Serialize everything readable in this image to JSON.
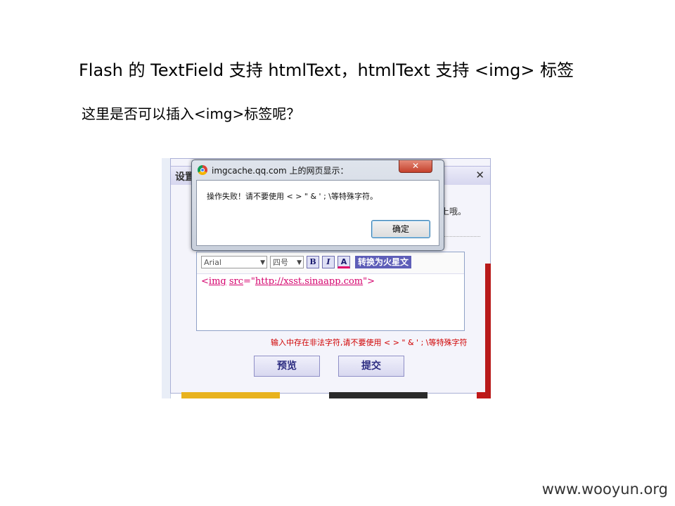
{
  "slide": {
    "title": "Flash 的 TextField 支持 htmlText，htmlText 支持 <img> 标签",
    "question": "这里是否可以插入<img>标签呢？",
    "watermark": "www.wooyun.org"
  },
  "panel": {
    "header_text": "设置",
    "close_glyph": "✕",
    "note_partial": "上哦。"
  },
  "editor": {
    "font_select": "Arial",
    "size_select": "四号",
    "bold_label": "B",
    "italic_label": "I",
    "color_label": "A",
    "convert_label": "转换为火星文",
    "content_prefix": "<",
    "content_tag": "img",
    "content_space": " ",
    "content_attr": "src",
    "content_value_open": "=\"",
    "content_url": "http://xsst.sinaapp.com",
    "content_suffix": "\">"
  },
  "warning": "输入中存在非法字符,请不要使用 < > \" & ' ; \\等特殊字符",
  "buttons": {
    "preview": "预览",
    "submit": "提交"
  },
  "alert": {
    "title": "imgcache.qq.com 上的网页显示：",
    "close_glyph": "✕",
    "message": "操作失败！请不要使用 < > \" & ' ; \\等特殊字符。",
    "ok_label": "确定"
  },
  "colors": {
    "editor_text": "#d4006c",
    "warning_text": "#d00000",
    "convert_button": "#5e5eb8"
  }
}
